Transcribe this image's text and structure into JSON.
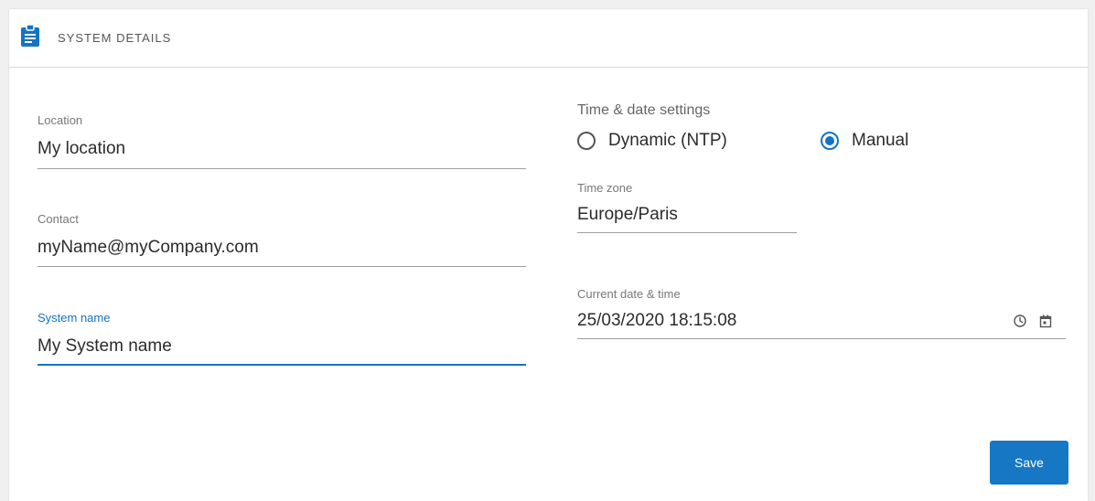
{
  "header": {
    "title": "SYSTEM DETAILS",
    "icon": "clipboard-icon"
  },
  "left_fields": {
    "location": {
      "label": "Location",
      "value": "My location"
    },
    "contact": {
      "label": "Contact",
      "value": "myName@myCompany.com"
    },
    "system_name": {
      "label": "System name",
      "value": "My System name",
      "focused": true
    }
  },
  "time_settings": {
    "heading": "Time & date settings",
    "options": [
      {
        "label": "Dynamic (NTP)",
        "checked": false
      },
      {
        "label": "Manual",
        "checked": true
      }
    ],
    "timezone": {
      "label": "Time zone",
      "value": "Europe/Paris"
    },
    "current": {
      "label": "Current date & time",
      "value": "25/03/2020 18:15:08",
      "icons": [
        "clock-icon",
        "calendar-icon"
      ]
    }
  },
  "actions": {
    "save_label": "Save"
  },
  "colors": {
    "accent": "#1474c4",
    "button": "#1677c4",
    "underline": "#9e9e9e"
  }
}
